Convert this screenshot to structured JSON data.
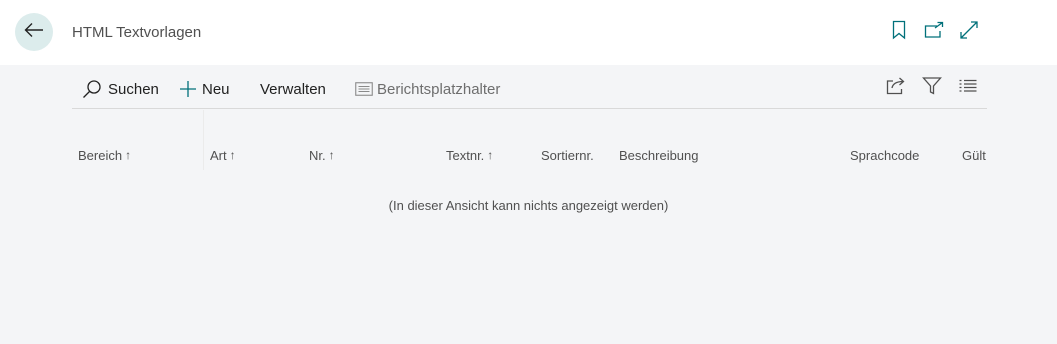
{
  "header": {
    "title": "HTML Textvorlagen",
    "back_icon": "arrow-left-icon",
    "actions": [
      "bookmark-icon",
      "open-new-window-icon",
      "expand-icon"
    ]
  },
  "toolbar": {
    "search_label": "Suchen",
    "new_label": "Neu",
    "manage_label": "Verwalten",
    "placeholder_label": "Berichtsplatzhalter",
    "right_actions": [
      "share-icon",
      "filter-icon",
      "list-view-icon"
    ]
  },
  "grid": {
    "columns": [
      {
        "label": "Bereich",
        "sorted": true
      },
      {
        "label": "Art",
        "sorted": true
      },
      {
        "label": "Nr.",
        "sorted": true
      },
      {
        "label": "Textnr.",
        "sorted": true
      },
      {
        "label": "Sortiernr.",
        "sorted": false
      },
      {
        "label": "Beschreibung",
        "sorted": false
      },
      {
        "label": "Sprachcode",
        "sorted": false
      },
      {
        "label": "Gült",
        "sorted": false
      }
    ],
    "sort_arrow": "↑",
    "empty_message": "(In dieser Ansicht kann nichts angezeigt werden)"
  },
  "colors": {
    "accent": "#00707a",
    "back_button_bg": "#dcecec",
    "page_bg": "#f4f5f7"
  }
}
